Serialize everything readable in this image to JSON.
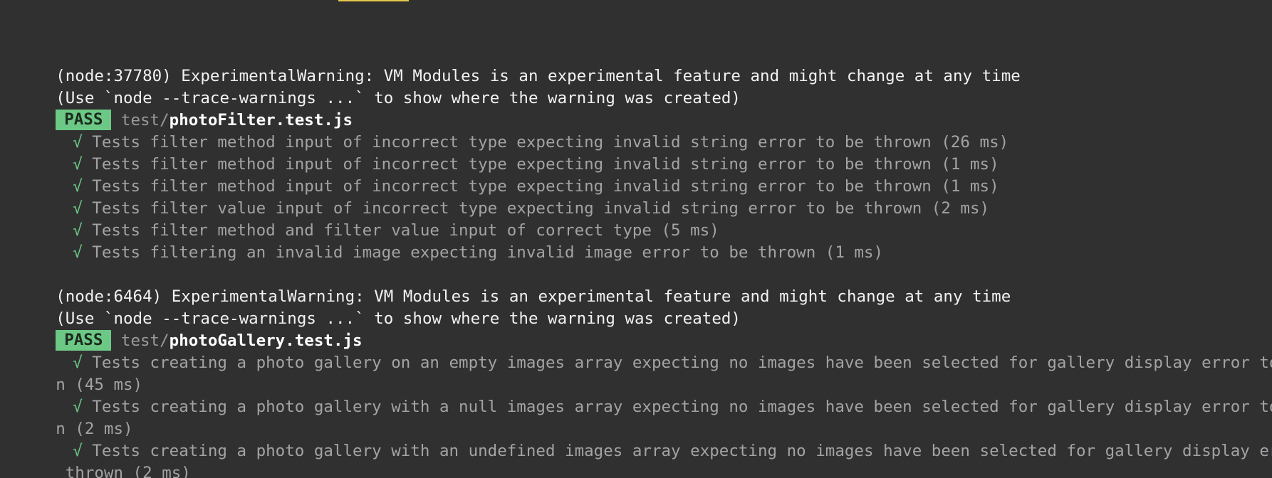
{
  "accent": {
    "pass_bg": "#6cc985",
    "background": "#303031",
    "check": "#6cc985"
  },
  "block1": {
    "warning": "(node:37780) ExperimentalWarning: VM Modules is an experimental feature and might change at any time",
    "hint": "(Use `node --trace-warnings ...` to show where the warning was created)",
    "status": "PASS",
    "file_dir": "test/",
    "file_name": "photoFilter.test.js",
    "check_glyph": "√",
    "tests": [
      "Tests filter method input of incorrect type expecting invalid string error to be thrown (26 ms)",
      "Tests filter method input of incorrect type expecting invalid string error to be thrown (1 ms)",
      "Tests filter method input of incorrect type expecting invalid string error to be thrown (1 ms)",
      "Tests filter value input of incorrect type expecting invalid string error to be thrown (2 ms)",
      "Tests filter method and filter value input of correct type (5 ms)",
      "Tests filtering an invalid image expecting invalid image error to be thrown (1 ms)"
    ]
  },
  "block2": {
    "warning": "(node:6464) ExperimentalWarning: VM Modules is an experimental feature and might change at any time",
    "hint": "(Use `node --trace-warnings ...` to show where the warning was created)",
    "status": "PASS",
    "file_dir": "test/",
    "file_name": "photoGallery.test.js",
    "check_glyph": "√",
    "tests": [
      {
        "line1": "Tests creating a photo gallery on an empty images array expecting no images have been selected for gallery display error to be throw",
        "line2": "n (45 ms)"
      },
      {
        "line1": "Tests creating a photo gallery with a null images array expecting no images have been selected for gallery display error to be throw",
        "line2": "n (2 ms)"
      },
      {
        "line1": "Tests creating a photo gallery with an undefined images array expecting no images have been selected for gallery display error to be",
        "line2": " thrown (2 ms)"
      }
    ]
  }
}
